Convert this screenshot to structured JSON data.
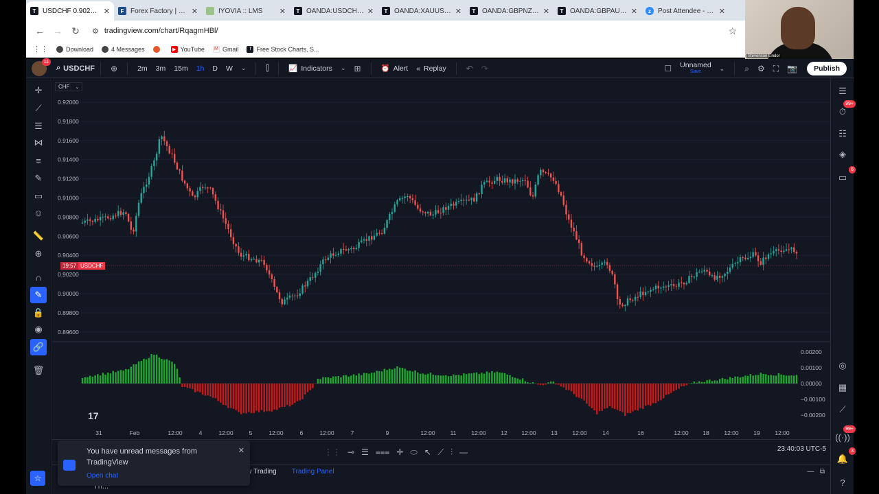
{
  "browser": {
    "tabs": [
      {
        "title": "USDCHF 0.90288 ▼",
        "active": true,
        "favicon": "TV"
      },
      {
        "title": "Forex Factory | Fore",
        "active": false,
        "favicon": "FF"
      },
      {
        "title": "IYOVIA :: LMS",
        "active": false,
        "favicon": "IY"
      },
      {
        "title": "OANDA:USDCHF Ch",
        "active": false,
        "favicon": "TV"
      },
      {
        "title": "OANDA:XAUUSD Ch",
        "active": false,
        "favicon": "TV"
      },
      {
        "title": "OANDA:GBPNZD Ch",
        "active": false,
        "favicon": "TV"
      },
      {
        "title": "OANDA:GBPAUD Ch",
        "active": false,
        "favicon": "TV"
      },
      {
        "title": "Post Attendee - Zoo",
        "active": false,
        "favicon": "zm"
      }
    ],
    "url": "tradingview.com/chart/RqagmHBl/",
    "bookmarks": [
      "Download",
      "4 Messages",
      "",
      "YouTube",
      "Gmail",
      "Free Stock Charts, S..."
    ]
  },
  "webcam": {
    "name": "Stevenson Lindor"
  },
  "toolbar": {
    "avatar_badge": "11",
    "symbol": "USDCHF",
    "intervals": [
      "2m",
      "3m",
      "15m",
      "1h",
      "D",
      "W"
    ],
    "selected_interval": "1h",
    "indicators_label": "Indicators",
    "alert_label": "Alert",
    "replay_label": "Replay",
    "layout_name": "Unnamed",
    "layout_save": "Save",
    "publish_label": "Publish"
  },
  "right_bar": {
    "badge_alerts": "99+",
    "badge_chat": "6",
    "badge_ideas": "99+",
    "badge_notifications": "3"
  },
  "chart": {
    "currency": "CHF",
    "price_label_time": "19:57",
    "price_label_symbol": "USDCHF",
    "y_ticks": [
      "0.92000",
      "0.91800",
      "0.91600",
      "0.91400",
      "0.91200",
      "0.91000",
      "0.90800",
      "0.90600",
      "0.90400",
      "0.90200",
      "0.90000",
      "0.89800",
      "0.89600"
    ],
    "indicator_ticks": [
      "0.00200",
      "0.00100",
      "0.00000",
      "−0.00100",
      "−0.00200"
    ],
    "x_ticks": [
      "31",
      "Feb",
      "12:00",
      "4",
      "12:00",
      "5",
      "12:00",
      "6",
      "12:00",
      "7",
      "9",
      "12:00",
      "11",
      "12:00",
      "12",
      "12:00",
      "13",
      "12:00",
      "14",
      "16",
      "12:00",
      "18",
      "12:00",
      "19",
      "12:00"
    ],
    "colors": {
      "up": "#26a69a",
      "down": "#ef5350",
      "bg": "#131722",
      "hist_up": "#1fa831",
      "hist_down": "#c41a1a"
    }
  },
  "bottom": {
    "clock": "23:40:03 UTC-5",
    "tab_paper": "ay Trading",
    "tab_trading_panel": "Trading Panel",
    "partial_text": "Th..."
  },
  "notification": {
    "message": "You have unread messages from TradingView",
    "link": "Open chat"
  }
}
